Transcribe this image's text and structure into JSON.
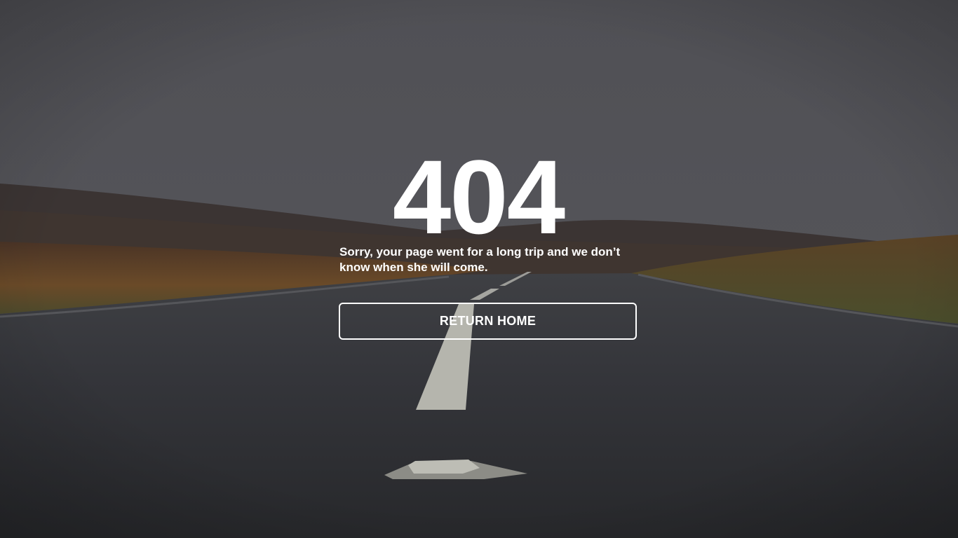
{
  "error_page": {
    "code": "404",
    "message": "Sorry, your page went for a long trip and we don’t know when she will come.",
    "button_label": "RETURN HOME"
  },
  "colors": {
    "text": "#ffffff",
    "sky": "#4e4f54",
    "road": "#2f3034",
    "grass": "#6b4a2a"
  }
}
